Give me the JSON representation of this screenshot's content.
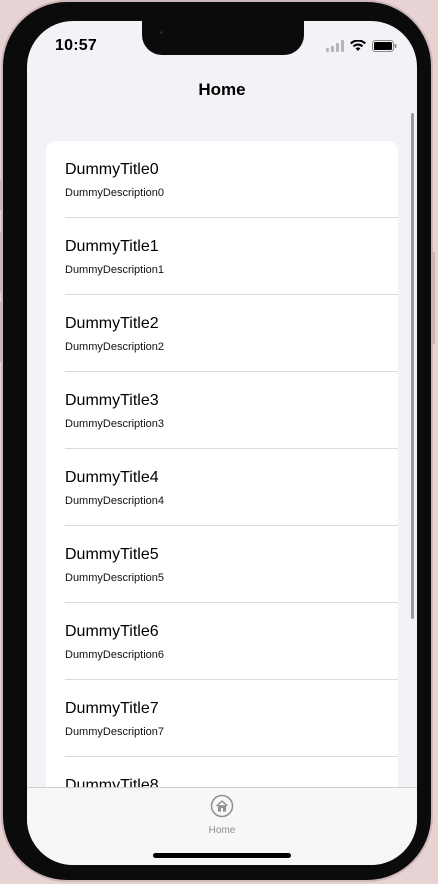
{
  "status_bar": {
    "time": "10:57"
  },
  "nav": {
    "title": "Home"
  },
  "list": {
    "items": [
      {
        "title": "DummyTitle0",
        "description": "DummyDescription0"
      },
      {
        "title": "DummyTitle1",
        "description": "DummyDescription1"
      },
      {
        "title": "DummyTitle2",
        "description": "DummyDescription2"
      },
      {
        "title": "DummyTitle3",
        "description": "DummyDescription3"
      },
      {
        "title": "DummyTitle4",
        "description": "DummyDescription4"
      },
      {
        "title": "DummyTitle5",
        "description": "DummyDescription5"
      },
      {
        "title": "DummyTitle6",
        "description": "DummyDescription6"
      },
      {
        "title": "DummyTitle7",
        "description": "DummyDescription7"
      },
      {
        "title": "DummyTitle8",
        "description": ""
      }
    ]
  },
  "tab_bar": {
    "tabs": [
      {
        "label": "Home",
        "icon": "house-icon",
        "selected": true
      }
    ]
  },
  "colors": {
    "background": "#f2f2f7",
    "card": "#ffffff",
    "separator": "#d9d9de",
    "tab_inactive": "#8e8e93",
    "frame": "#0b0b0b"
  }
}
